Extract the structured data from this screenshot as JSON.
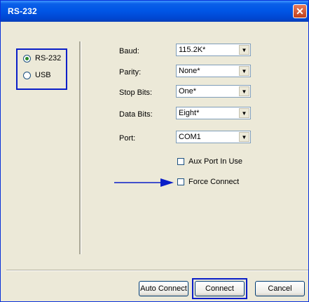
{
  "window": {
    "title": "RS-232",
    "close_glyph": "✕"
  },
  "interface": {
    "options": [
      {
        "label": "RS-232",
        "selected": true
      },
      {
        "label": "USB",
        "selected": false
      }
    ]
  },
  "settings": {
    "fields": [
      {
        "label": "Baud:",
        "value": "115.2K*"
      },
      {
        "label": "Parity:",
        "value": "None*"
      },
      {
        "label": "Stop Bits:",
        "value": "One*"
      },
      {
        "label": "Data Bits:",
        "value": "Eight*"
      },
      {
        "label": "Port:",
        "value": "COM1"
      }
    ],
    "checkboxes": [
      {
        "label": "Aux Port In Use",
        "checked": false
      },
      {
        "label": "Force Connect",
        "checked": false
      }
    ]
  },
  "buttons": {
    "auto_connect": "Auto Connect",
    "connect": "Connect",
    "cancel": "Cancel"
  },
  "colors": {
    "highlight": "#0a1ec8",
    "titlebar": "#0055e5",
    "face": "#ece9d8"
  }
}
